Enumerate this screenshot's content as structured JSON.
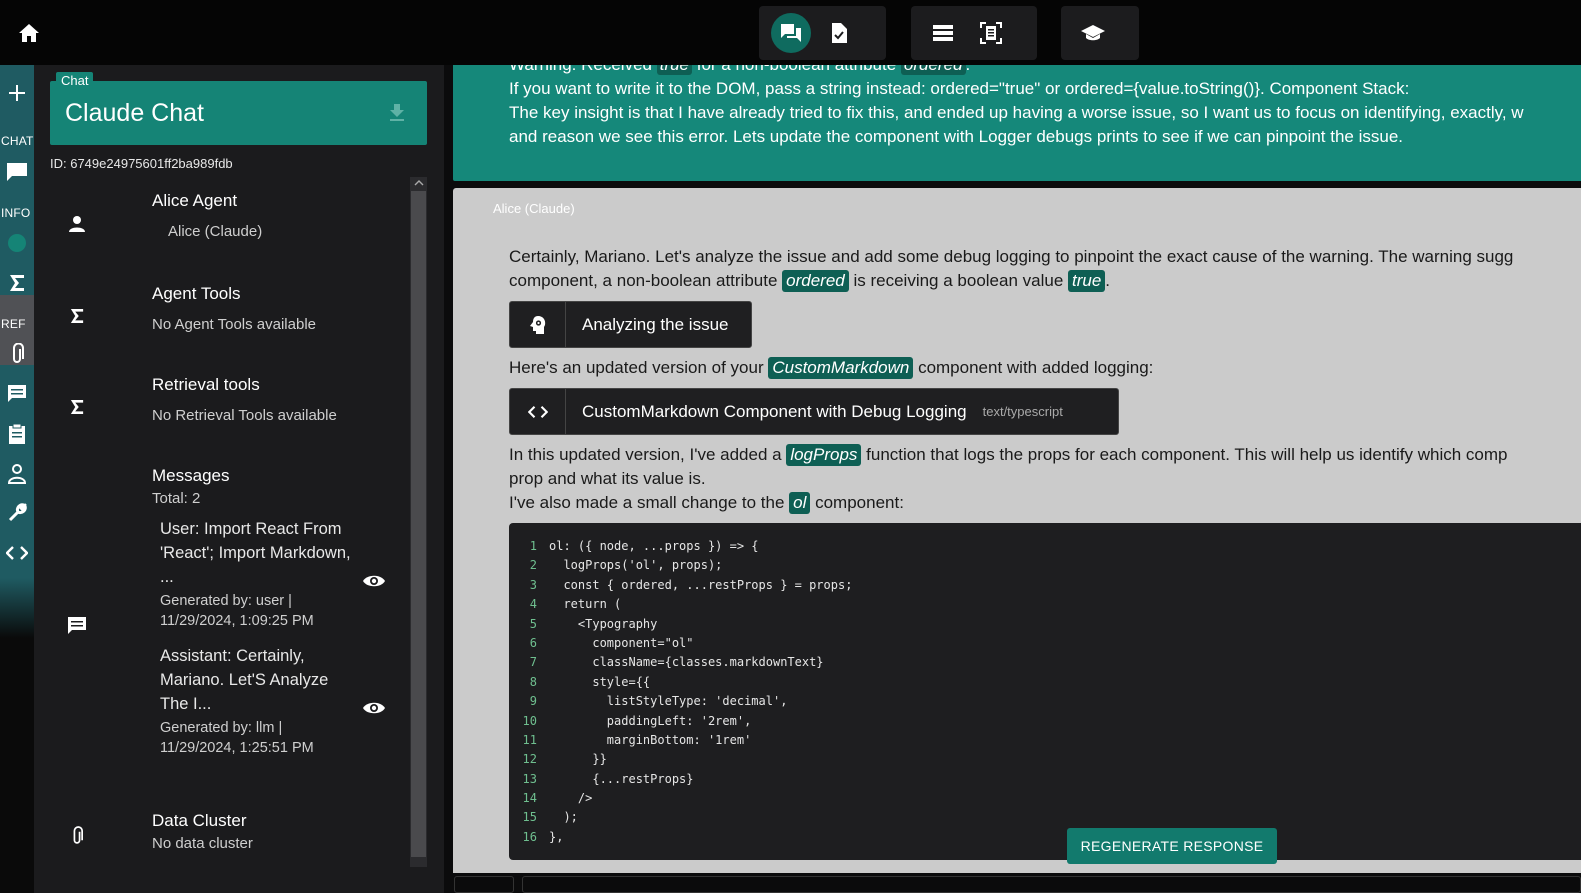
{
  "topbar": {
    "home_icon": "home-icon",
    "groups": [
      {
        "buttons": [
          "chat-bubbles-icon",
          "document-check-icon"
        ]
      },
      {
        "buttons": [
          "list-icon",
          "document-scan-icon"
        ]
      },
      {
        "buttons": [
          "graduation-cap-icon"
        ]
      }
    ]
  },
  "rail": {
    "chat_label": "CHAT",
    "info_label": "INFO",
    "ref_label": "REF"
  },
  "sidebar": {
    "chat_tag": "Chat",
    "chat_title": "Claude Chat",
    "chat_id": "ID: 6749e24975601ff2ba989fdb",
    "agent": {
      "title": "Alice Agent",
      "value": "Alice (Claude)"
    },
    "agent_tools": {
      "title": "Agent Tools",
      "value": "No Agent Tools available"
    },
    "retrieval_tools": {
      "title": "Retrieval tools",
      "value": "No Retrieval Tools available"
    },
    "messages": {
      "title": "Messages",
      "total": "Total: 2",
      "items": [
        {
          "title": "User: Import React From 'React'; Import Markdown, ...",
          "meta1": "Generated by: user |",
          "meta2": "11/29/2024, 1:09:25 PM"
        },
        {
          "title": "Assistant: Certainly, Mariano. Let'S Analyze The I...",
          "meta1": "Generated by: llm |",
          "meta2": "11/29/2024, 1:25:51 PM"
        }
      ]
    },
    "data_cluster": {
      "title": "Data Cluster",
      "value": "No data cluster"
    }
  },
  "user_message": {
    "line1_a": "Warning: Received ",
    "line1_code1": "true",
    "line1_b": " for a non-boolean attribute ",
    "line1_code2": "ordered",
    "line1_c": ".",
    "line2": "If you want to write it to the DOM, pass a string instead: ordered=\"true\" or ordered={value.toString()}. Component Stack:",
    "line3": "The key insight is that I have already tried to fix this, and ended up having a worse issue, so I want us to focus on identifying, exactly, w",
    "line4": "and reason we see this error. Lets update the component with Logger debugs prints to see if we can pinpoint the issue."
  },
  "assistant": {
    "label": "Alice (Claude)",
    "p1_line1": "Certainly, Mariano. Let's analyze the issue and add some debug logging to pinpoint the exact cause of the warning. The warning sugg",
    "p1_line2_a": "component, a non-boolean attribute ",
    "p1_line2_code1": "ordered",
    "p1_line2_b": " is receiving a boolean value ",
    "p1_line2_code2": "true",
    "p1_line2_c": ".",
    "artifact1": "Analyzing the issue",
    "p2_a": "Here's an updated version of your ",
    "p2_code": "CustomMarkdown",
    "p2_b": " component with added logging:",
    "artifact2": "CustomMarkdown Component with Debug Logging",
    "artifact2_type": "text/typescript",
    "p3_a": "In this updated version, I've added a ",
    "p3_code": "logProps",
    "p3_b": " function that logs the props for each component. This will help us identify which comp",
    "p3_line2": "prop and what its value is.",
    "p4_a": "I've also made a small change to the ",
    "p4_code": "ol",
    "p4_b": " component:",
    "code_lines": [
      "ol: ({ node, ...props }) => {",
      "  logProps('ol', props);",
      "  const { ordered, ...restProps } = props;",
      "  return (",
      "    <Typography",
      "      component=\"ol\"",
      "      className={classes.markdownText}",
      "      style={{",
      "        listStyleType: 'decimal',",
      "        paddingLeft: '2rem',",
      "        marginBottom: '1rem'",
      "      }}",
      "      {...restProps}",
      "    />",
      "  );",
      "},"
    ],
    "regenerate": "REGENERATE RESPONSE"
  }
}
